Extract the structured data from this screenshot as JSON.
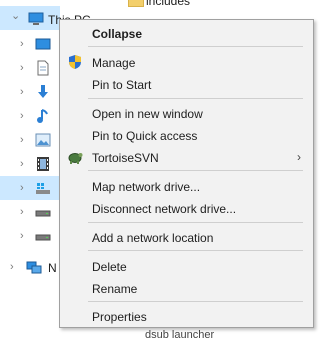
{
  "tree": {
    "this_pc_label": "This PC",
    "network_label": "N",
    "background_includes_label": "includes",
    "background_bottom_label": "dsub launcher"
  },
  "menu": {
    "items": [
      {
        "id": "collapse",
        "label": "Collapse",
        "bold": true
      },
      {
        "id": "manage",
        "label": "Manage",
        "icon": "shield-icon"
      },
      {
        "id": "pin_to_start",
        "label": "Pin to Start"
      },
      {
        "id": "open_new_window",
        "label": "Open in new window"
      },
      {
        "id": "pin_quick_access",
        "label": "Pin to Quick access"
      },
      {
        "id": "tortoisesvn",
        "label": "TortoiseSVN",
        "icon": "tortoise-icon",
        "submenu": true
      },
      {
        "id": "map_network_drive",
        "label": "Map network drive..."
      },
      {
        "id": "disconnect_network_drive",
        "label": "Disconnect network drive..."
      },
      {
        "id": "add_network_location",
        "label": "Add a network location"
      },
      {
        "id": "delete",
        "label": "Delete"
      },
      {
        "id": "rename",
        "label": "Rename"
      },
      {
        "id": "properties",
        "label": "Properties"
      }
    ]
  },
  "colors": {
    "menu_background": "#f2f2f2",
    "selection_highlight": "#cce8ff",
    "separator": "#cfcfcf"
  }
}
